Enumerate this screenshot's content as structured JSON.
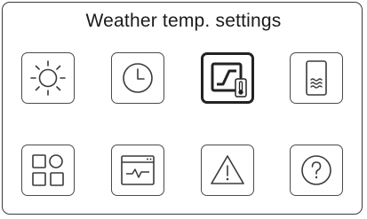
{
  "screen": {
    "title": "Weather temp. settings"
  },
  "tiles": [
    {
      "icon": "sun-icon",
      "selected": false
    },
    {
      "icon": "clock-icon",
      "selected": false
    },
    {
      "icon": "weather-temp-curve-icon",
      "selected": true
    },
    {
      "icon": "water-tank-icon",
      "selected": false
    },
    {
      "icon": "grid-menu-icon",
      "selected": false
    },
    {
      "icon": "monitor-graph-icon",
      "selected": false
    },
    {
      "icon": "warning-icon",
      "selected": false
    },
    {
      "icon": "help-icon",
      "selected": false
    }
  ],
  "colors": {
    "stroke": "#3a3a3a",
    "selected_border": "#222222",
    "background": "#ffffff"
  }
}
